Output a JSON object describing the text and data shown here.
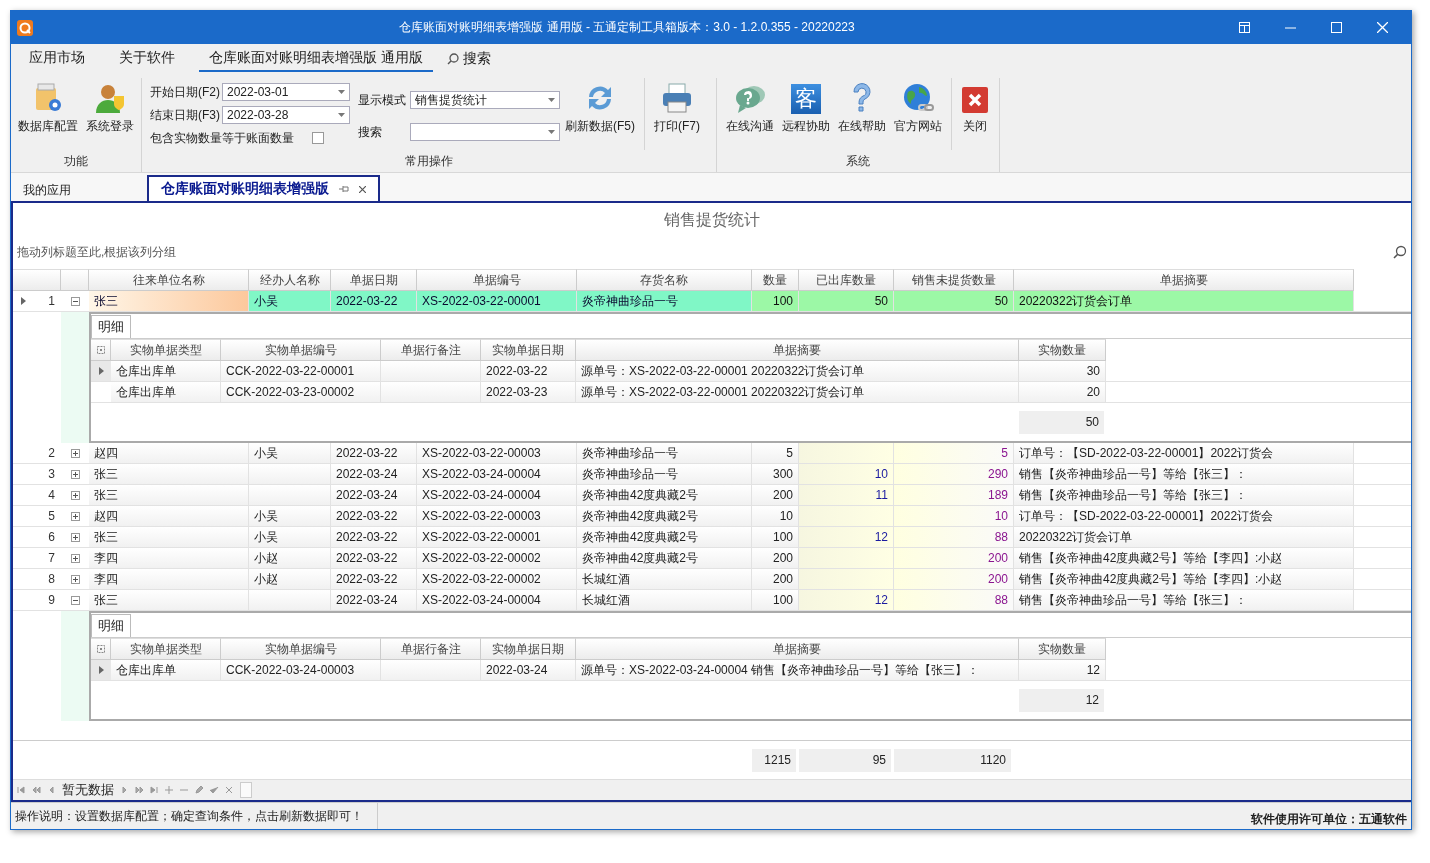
{
  "window": {
    "title": "仓库账面对账明细表增强版 通用版 - 五通定制工具箱版本：3.0 - 1.2.0.355 - 20220223"
  },
  "menu": [
    {
      "label": "应用市场",
      "selected": false
    },
    {
      "label": "关于软件",
      "selected": false
    },
    {
      "label": "仓库账面对账明细表增强版 通用版",
      "selected": true
    }
  ],
  "menu_search": "搜索",
  "ribbon": {
    "function": {
      "label": "功能",
      "buttons": [
        "数据库配置",
        "系统登录"
      ]
    },
    "common": {
      "label": "常用操作",
      "start_date": {
        "label": "开始日期(F2)",
        "value": "2022-03-01"
      },
      "end_date": {
        "label": "结束日期(F3)",
        "value": "2022-03-28"
      },
      "include_equal": {
        "label": "包含实物数量等于账面数量",
        "checked": false
      },
      "display_mode": {
        "label": "显示模式",
        "value": "销售提货统计"
      },
      "search": {
        "label": "搜索"
      },
      "buttons": [
        "刷新数据(F5)",
        "打印(F7)"
      ]
    },
    "system": {
      "label": "系统",
      "badge_glyph": "客",
      "buttons": [
        "在线沟通",
        "远程协助",
        "在线帮助",
        "官方网站"
      ]
    },
    "close": "关闭"
  },
  "doc_tabs": [
    {
      "label": "我的应用",
      "selected": false
    },
    {
      "label": "仓库账面对账明细表增强版",
      "selected": true
    }
  ],
  "grid": {
    "title": "销售提货统计",
    "group_hint": "拖动列标题至此,根据该列分组",
    "columns": [
      "往来单位名称",
      "经办人名称",
      "单据日期",
      "单据编号",
      "存货名称",
      "数量",
      "已出库数量",
      "销售未提货数量",
      "单据摘要"
    ],
    "rows": [
      {
        "num": "1",
        "selected": true,
        "expanded": true,
        "party": "张三",
        "handler": "小吴",
        "date": "2022-03-22",
        "doc": "XS-2022-03-22-00001",
        "item": "炎帝神曲珍品一号",
        "qty": "100",
        "shipped": "50",
        "pending": "50",
        "summary": "20220322订货会订单",
        "detail": {
          "tab": "明细",
          "columns": [
            "实物单据类型",
            "实物单据编号",
            "单据行备注",
            "实物单据日期",
            "单据摘要",
            "实物数量"
          ],
          "rows": [
            {
              "selected": true,
              "type": "仓库出库单",
              "doc": "CCK-2022-03-22-00001",
              "date": "2022-03-22",
              "summary": "源单号：XS-2022-03-22-00001 20220322订货会订单",
              "qty": "30"
            },
            {
              "selected": false,
              "type": "仓库出库单",
              "doc": "CCK-2022-03-23-00002",
              "date": "2022-03-23",
              "summary": "源单号：XS-2022-03-22-00001 20220322订货会订单",
              "qty": "20"
            }
          ],
          "total": "50"
        }
      },
      {
        "num": "2",
        "selected": false,
        "expanded": false,
        "party": "赵四",
        "handler": "小吴",
        "date": "2022-03-22",
        "doc": "XS-2022-03-22-00003",
        "item": "炎帝神曲珍品一号",
        "qty": "5",
        "pending": "5",
        "summary": "订单号：【SD-2022-03-22-00001】2022订货会"
      },
      {
        "num": "3",
        "selected": false,
        "expanded": false,
        "party": "张三",
        "date": "2022-03-24",
        "doc": "XS-2022-03-24-00004",
        "item": "炎帝神曲珍品一号",
        "qty": "300",
        "shipped": "10",
        "pending": "290",
        "summary": "销售【炎帝神曲珍品一号】等给【张三】："
      },
      {
        "num": "4",
        "selected": false,
        "expanded": false,
        "party": "张三",
        "date": "2022-03-24",
        "doc": "XS-2022-03-24-00004",
        "item": "炎帝神曲42度典藏2号",
        "qty": "200",
        "shipped": "11",
        "pending": "189",
        "summary": "销售【炎帝神曲珍品一号】等给【张三】："
      },
      {
        "num": "5",
        "selected": false,
        "expanded": false,
        "party": "赵四",
        "handler": "小吴",
        "date": "2022-03-22",
        "doc": "XS-2022-03-22-00003",
        "item": "炎帝神曲42度典藏2号",
        "qty": "10",
        "pending": "10",
        "summary": "订单号：【SD-2022-03-22-00001】2022订货会"
      },
      {
        "num": "6",
        "selected": false,
        "expanded": false,
        "party": "张三",
        "handler": "小吴",
        "date": "2022-03-22",
        "doc": "XS-2022-03-22-00001",
        "item": "炎帝神曲42度典藏2号",
        "qty": "100",
        "shipped": "12",
        "pending": "88",
        "summary": "20220322订货会订单"
      },
      {
        "num": "7",
        "selected": false,
        "expanded": false,
        "party": "李四",
        "handler": "小赵",
        "date": "2022-03-22",
        "doc": "XS-2022-03-22-00002",
        "item": "炎帝神曲42度典藏2号",
        "qty": "200",
        "pending": "200",
        "summary": "销售【炎帝神曲42度典藏2号】等给【李四】:小赵"
      },
      {
        "num": "8",
        "selected": false,
        "expanded": false,
        "party": "李四",
        "handler": "小赵",
        "date": "2022-03-22",
        "doc": "XS-2022-03-22-00002",
        "item": "长城红酒",
        "qty": "200",
        "pending": "200",
        "summary": "销售【炎帝神曲42度典藏2号】等给【李四】:小赵"
      },
      {
        "num": "9",
        "selected": false,
        "expanded": true,
        "party": "张三",
        "date": "2022-03-24",
        "doc": "XS-2022-03-24-00004",
        "item": "长城红酒",
        "qty": "100",
        "shipped": "12",
        "pending": "88",
        "summary": "销售【炎帝神曲珍品一号】等给【张三】：",
        "detail": {
          "tab": "明细",
          "columns": [
            "实物单据类型",
            "实物单据编号",
            "单据行备注",
            "实物单据日期",
            "单据摘要",
            "实物数量"
          ],
          "rows": [
            {
              "selected": true,
              "type": "仓库出库单",
              "doc": "CCK-2022-03-24-00003",
              "date": "2022-03-24",
              "summary": "源单号：XS-2022-03-24-00004 销售【炎帝神曲珍品一号】等给【张三】：",
              "qty": "12"
            }
          ],
          "total": "12"
        }
      }
    ],
    "totals": {
      "qty": "1215",
      "shipped": "95",
      "pending": "1120"
    },
    "navigator_text": "暂无数据"
  },
  "status_bar": {
    "hint": "操作说明：设置数据库配置；确定查询条件，点击刷新数据即可！",
    "license": "软件使用许可单位：五通软件"
  }
}
